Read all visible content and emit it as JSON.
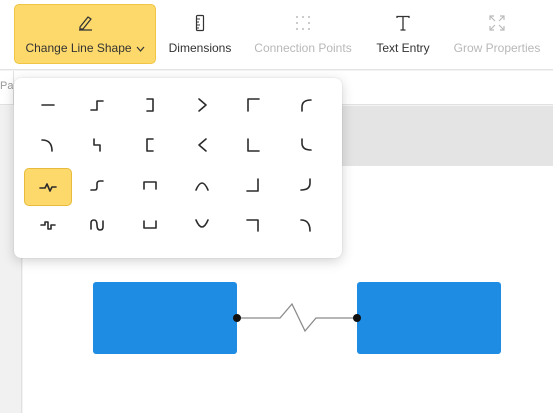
{
  "toolbar": {
    "items": [
      {
        "label": "Change Line Shape",
        "icon": "pen-icon",
        "active": true,
        "has_dropdown": true
      },
      {
        "label": "Dimensions",
        "icon": "ruler-icon",
        "active": false
      },
      {
        "label": "Connection Points",
        "icon": "dotted-grid-icon",
        "disabled": true
      },
      {
        "label": "Text Entry",
        "icon": "text-t-icon",
        "active": false
      },
      {
        "label": "Grow Properties",
        "icon": "expand-corners-icon",
        "disabled": true
      }
    ]
  },
  "page_tab": {
    "label": "Pag"
  },
  "line_shape_menu": {
    "selected_index": 12,
    "options": [
      "straight",
      "step-right",
      "bracket-right",
      "chevron-right",
      "corner-top-left",
      "arc-top-left",
      "arc-top-right",
      "zigzag-step",
      "bracket-left",
      "chevron-left",
      "corner-bottom-left",
      "arc-bottom-left",
      "lightning",
      "s-step",
      "bracket-up",
      "arch-up",
      "corner-bottom-right",
      "arc-bottom-right",
      "double-step",
      "wave",
      "bracket-down",
      "arch-down",
      "corner-top-right",
      "arc-top-right-hook"
    ]
  },
  "colors": {
    "accent": "#fdd96b",
    "shape_fill": "#1e8ce3",
    "connector": "#8a8a8a"
  }
}
